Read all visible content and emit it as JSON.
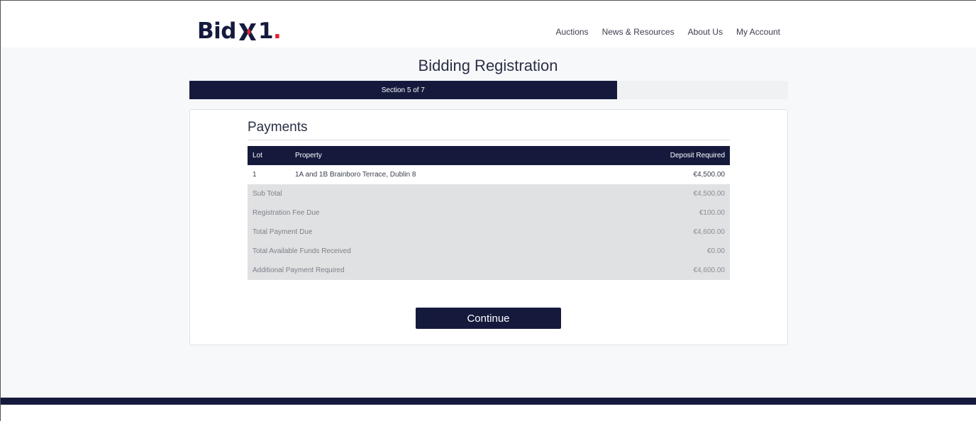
{
  "brand": {
    "logo_text_left": "Bid",
    "logo_text_right": "1",
    "logo_dot": ".",
    "navy": "#151a3d",
    "red": "#e0232a"
  },
  "nav": {
    "items": [
      "Auctions",
      "News & Resources",
      "About Us",
      "My Account"
    ]
  },
  "page": {
    "title": "Bidding Registration"
  },
  "progress": {
    "label": "Section 5 of 7",
    "current": 5,
    "total": 7,
    "fraction": 0.714
  },
  "payments": {
    "title": "Payments",
    "columns": {
      "lot": "Lot",
      "property": "Property",
      "deposit": "Deposit Required"
    },
    "rows": [
      {
        "lot": "1",
        "property": "1A and 1B Brainboro Terrace, Dublin 8",
        "deposit": "€4,500.00"
      }
    ],
    "summary": [
      {
        "label": "Sub Total",
        "value": "€4,500.00"
      },
      {
        "label": "Registration Fee Due",
        "value": "€100.00"
      },
      {
        "label": "Total Payment Due",
        "value": "€4,600.00"
      },
      {
        "label": "Total Available Funds Received",
        "value": "€0.00"
      },
      {
        "label": "Additional Payment Required",
        "value": "€4,600.00"
      }
    ]
  },
  "actions": {
    "continue_label": "Continue"
  }
}
